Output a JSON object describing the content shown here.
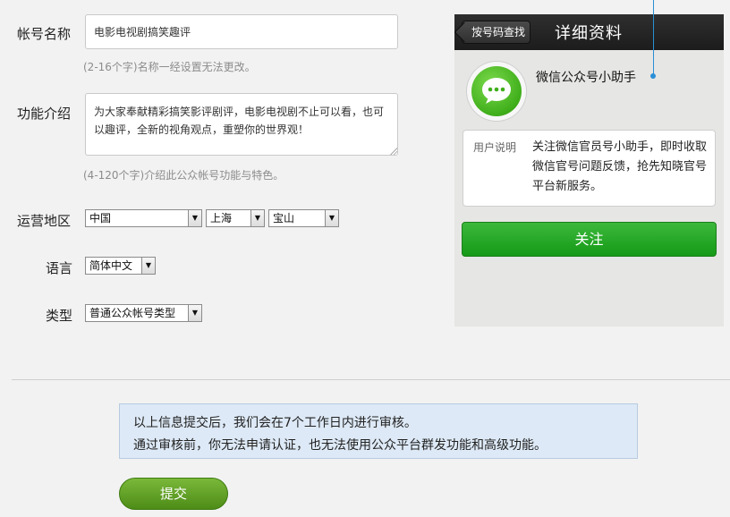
{
  "form": {
    "name": {
      "label": "帐号名称",
      "value": "电影电视剧搞笑趣评",
      "hint": "(2-16个字)名称一经设置无法更改。"
    },
    "intro": {
      "label": "功能介绍",
      "value": "为大家奉献精彩搞笑影评剧评，电影电视剧不止可以看，也可以趣评，全新的视角观点，重塑你的世界观！",
      "hint": "(4-120个字)介绍此公众帐号功能与特色。"
    },
    "region": {
      "label": "运营地区",
      "country": "中国",
      "province": "上海",
      "district": "宝山"
    },
    "language": {
      "label": "语言",
      "value": "简体中文"
    },
    "type": {
      "label": "类型",
      "value": "普通公众帐号类型"
    }
  },
  "notice": {
    "line1": "以上信息提交后，我们会在7个工作日内进行审核。",
    "line2": "通过审核前，你无法申请认证，也无法使用公众平台群发功能和高级功能。"
  },
  "submit_label": "提交",
  "preview": {
    "back_label": "按号码查找",
    "title": "详细资料",
    "account_name": "微信公众号小助手",
    "desc_label": "用户说明",
    "desc_text": "关注微信官员号小助手，即时收取微信官号问题反馈，抢先知晓官号平台新服务。",
    "follow_label": "关注"
  },
  "icons": {
    "avatar": "wechat-bubble-icon",
    "dropdown": "triangle-down-icon"
  },
  "colors": {
    "accent_green": "#1fa11f",
    "submit_green": "#5a9b1f",
    "notice_bg": "#dde9f6",
    "annotation_blue": "#2a8fd6"
  }
}
